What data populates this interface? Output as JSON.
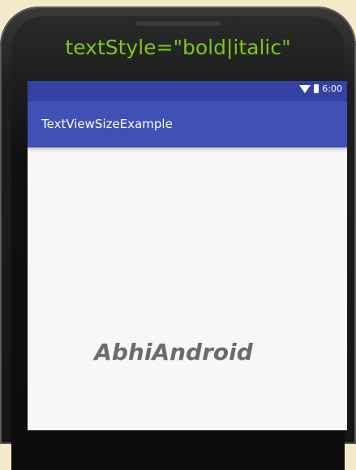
{
  "caption": {
    "text": "textStyle=\"bold|italic\""
  },
  "status_bar": {
    "time": "6:00",
    "icons": [
      "wifi-icon",
      "battery-icon"
    ]
  },
  "app_bar": {
    "title": "TextViewSizeExample"
  },
  "content": {
    "text": "AbhiAndroid"
  },
  "colors": {
    "caption": "#7cc61c",
    "status_bar": "#3443a3",
    "app_bar": "#3f51b5",
    "screen_bg": "#f7f7f7",
    "content_text": "#6b6b6b",
    "page_bg": "#f6e9c9"
  }
}
